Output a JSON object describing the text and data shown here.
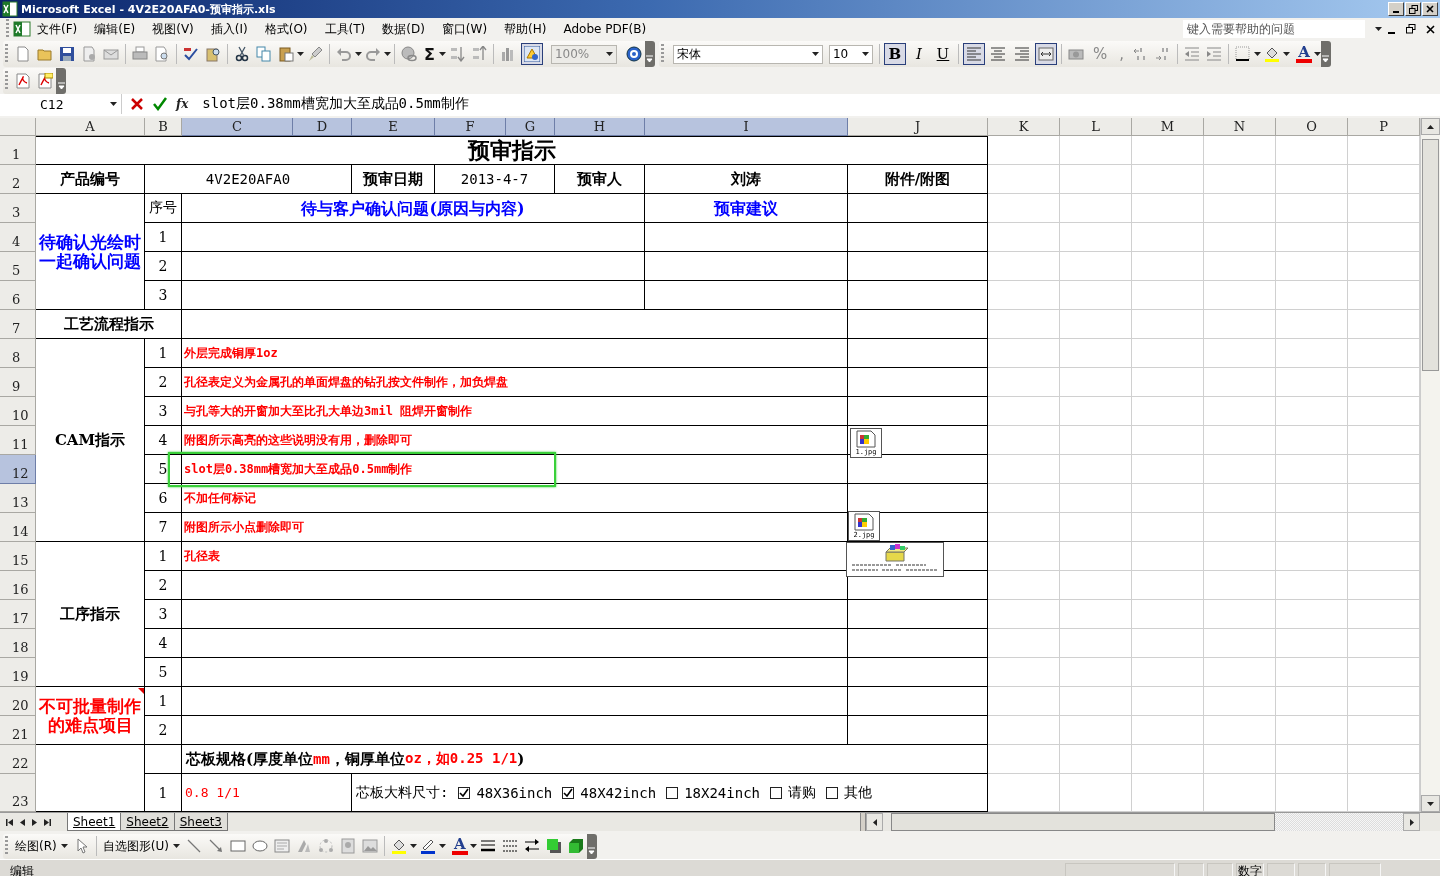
{
  "window": {
    "title": "Microsoft Excel - 4V2E20AFA0-预审指示.xls"
  },
  "menu": {
    "items": [
      "文件(F)",
      "编辑(E)",
      "视图(V)",
      "插入(I)",
      "格式(O)",
      "工具(T)",
      "数据(D)",
      "窗口(W)",
      "帮助(H)",
      "Adobe PDF(B)"
    ],
    "help_search": {
      "placeholder": "键入需要帮助的问题"
    }
  },
  "standard_toolbar": {
    "autosum": "Σ",
    "zoom": "100%"
  },
  "formatting_toolbar": {
    "font": "宋体",
    "size": "10",
    "percent": "%",
    "comma": ",",
    "font_color": "A",
    "style_buttons": [
      {
        "label": "B",
        "pressed": true
      },
      {
        "label": "I",
        "pressed": false
      },
      {
        "label": "U",
        "pressed": false
      }
    ],
    "align_buttons": [
      {
        "kind": "left",
        "pressed": true
      },
      {
        "kind": "center",
        "pressed": false
      },
      {
        "kind": "right",
        "pressed": false
      },
      {
        "kind": "merge",
        "pressed": true
      }
    ]
  },
  "formula_bar": {
    "name_box": "C12",
    "function_button": "fx",
    "content": "slot层0.38mm槽宽加大至成品0.5mm制作"
  },
  "columns": [
    {
      "label": "A",
      "selected": false
    },
    {
      "label": "B",
      "selected": false
    },
    {
      "label": "C",
      "selected": true
    },
    {
      "label": "D",
      "selected": true
    },
    {
      "label": "E",
      "selected": true
    },
    {
      "label": "F",
      "selected": true
    },
    {
      "label": "G",
      "selected": true
    },
    {
      "label": "H",
      "selected": true
    },
    {
      "label": "I",
      "selected": true
    },
    {
      "label": "J",
      "selected": false
    },
    {
      "label": "K",
      "selected": false
    },
    {
      "label": "L",
      "selected": false
    },
    {
      "label": "M",
      "selected": false
    },
    {
      "label": "N",
      "selected": false
    },
    {
      "label": "O",
      "selected": false
    },
    {
      "label": "P",
      "selected": false
    }
  ],
  "rows": [
    {
      "label": "1",
      "selected": false
    },
    {
      "label": "2",
      "selected": false
    },
    {
      "label": "3",
      "selected": false
    },
    {
      "label": "4",
      "selected": false
    },
    {
      "label": "5",
      "selected": false
    },
    {
      "label": "6",
      "selected": false
    },
    {
      "label": "7",
      "selected": false
    },
    {
      "label": "8",
      "selected": false
    },
    {
      "label": "9",
      "selected": false
    },
    {
      "label": "10",
      "selected": false
    },
    {
      "label": "11",
      "selected": false
    },
    {
      "label": "12",
      "selected": true
    },
    {
      "label": "13",
      "selected": false
    },
    {
      "label": "14",
      "selected": false
    },
    {
      "label": "15",
      "selected": false
    },
    {
      "label": "16",
      "selected": false
    },
    {
      "label": "17",
      "selected": false
    },
    {
      "label": "18",
      "selected": false
    },
    {
      "label": "19",
      "selected": false
    },
    {
      "label": "20",
      "selected": false
    },
    {
      "label": "21",
      "selected": false
    },
    {
      "label": "22",
      "selected": false
    },
    {
      "label": "23",
      "selected": false
    }
  ],
  "cells": [
    {
      "kind": "title",
      "text": "预审指示"
    },
    {
      "kind": "label",
      "text": "产品编号"
    },
    {
      "kind": "value",
      "text": "4V2E20AFA0"
    },
    {
      "kind": "label",
      "text": "预审日期"
    },
    {
      "kind": "value",
      "text": "2013-4-7"
    },
    {
      "kind": "label",
      "text": "预审人"
    },
    {
      "kind": "label",
      "text": "刘涛"
    },
    {
      "kind": "label",
      "text": "附件/附图"
    },
    {
      "kind": "question",
      "text": "待确认光绘时一起确认问题"
    },
    {
      "kind": "number",
      "text": "序号"
    },
    {
      "kind": "question",
      "text": "待与客户确认问题(原因与内容)"
    },
    {
      "kind": "question",
      "text": "预审建议"
    },
    {
      "kind": "number",
      "text": "1"
    },
    {
      "kind": "number",
      "text": "2"
    },
    {
      "kind": "number",
      "text": "3"
    },
    {
      "kind": "label",
      "text": "工艺流程指示"
    },
    {
      "kind": "label",
      "text": "CAM指示"
    },
    {
      "kind": "number",
      "text": "1"
    },
    {
      "kind": "number",
      "text": "2"
    },
    {
      "kind": "number",
      "text": "3"
    },
    {
      "kind": "number",
      "text": "4"
    },
    {
      "kind": "number",
      "text": "5"
    },
    {
      "kind": "number",
      "text": "6"
    },
    {
      "kind": "number",
      "text": "7"
    },
    {
      "kind": "instruction",
      "text": "外层完成铜厚1oz"
    },
    {
      "kind": "instruction",
      "text": "孔径表定义为金属孔的单面焊盘的钻孔按文件制作，加负焊盘"
    },
    {
      "kind": "instruction",
      "text": "与孔等大的开窗加大至比孔大单边3mil 阻焊开窗制作"
    },
    {
      "kind": "instruction",
      "text": "附图所示高亮的这些说明没有用，删除即可"
    },
    {
      "kind": "instruction",
      "text": "slot层0.38mm槽宽加大至成品0.5mm制作"
    },
    {
      "kind": "instruction",
      "text": "不加任何标记"
    },
    {
      "kind": "instruction",
      "text": "附图所示小点删除即可"
    },
    {
      "kind": "label",
      "text": "工序指示"
    },
    {
      "kind": "number",
      "text": "1"
    },
    {
      "kind": "number",
      "text": "2"
    },
    {
      "kind": "number",
      "text": "3"
    },
    {
      "kind": "number",
      "text": "4"
    },
    {
      "kind": "number",
      "text": "5"
    },
    {
      "kind": "instruction",
      "text": "孔径表"
    },
    {
      "kind": "difficulty",
      "text": "不可批量制作的难点项目",
      "has_comment": true
    },
    {
      "kind": "number",
      "text": "1"
    },
    {
      "kind": "number",
      "text": "2"
    },
    {
      "kind": "spec",
      "parts": [
        {
          "text": "芯板规格(厚度单位",
          "emphasis": false
        },
        {
          "text": "mm",
          "emphasis": true
        },
        {
          "text": "，铜厚单位",
          "emphasis": false
        },
        {
          "text": "oz，如0.25 1/1",
          "emphasis": true
        },
        {
          "text": ")",
          "emphasis": false
        }
      ]
    },
    {
      "kind": "number",
      "text": "1"
    },
    {
      "kind": "plain_red",
      "text": "0.8 1/1"
    },
    {
      "kind": "options",
      "text": "芯板大料尺寸:",
      "options": [
        {
          "label": "48X36inch",
          "checked": true
        },
        {
          "label": "48X42inch",
          "checked": true
        },
        {
          "label": "18X24inch",
          "checked": false
        },
        {
          "label": "请购",
          "checked": false
        },
        {
          "label": "其他",
          "checked": false
        }
      ]
    }
  ],
  "attachments": [
    {
      "kind": "image",
      "label": "1.jpg"
    },
    {
      "kind": "image",
      "label": "2.jpg"
    },
    {
      "kind": "package"
    }
  ],
  "sheet_tabs": [
    {
      "label": "Sheet1",
      "selected": true
    },
    {
      "label": "Sheet2",
      "selected": false
    },
    {
      "label": "Sheet3",
      "selected": false
    }
  ],
  "drawing_toolbar": {
    "draw_menu": "绘图(R)",
    "autoshapes_menu": "自选图形(U)",
    "font_color": "A"
  },
  "status_bar": {
    "mode": "编辑",
    "num_lock": "数字"
  }
}
